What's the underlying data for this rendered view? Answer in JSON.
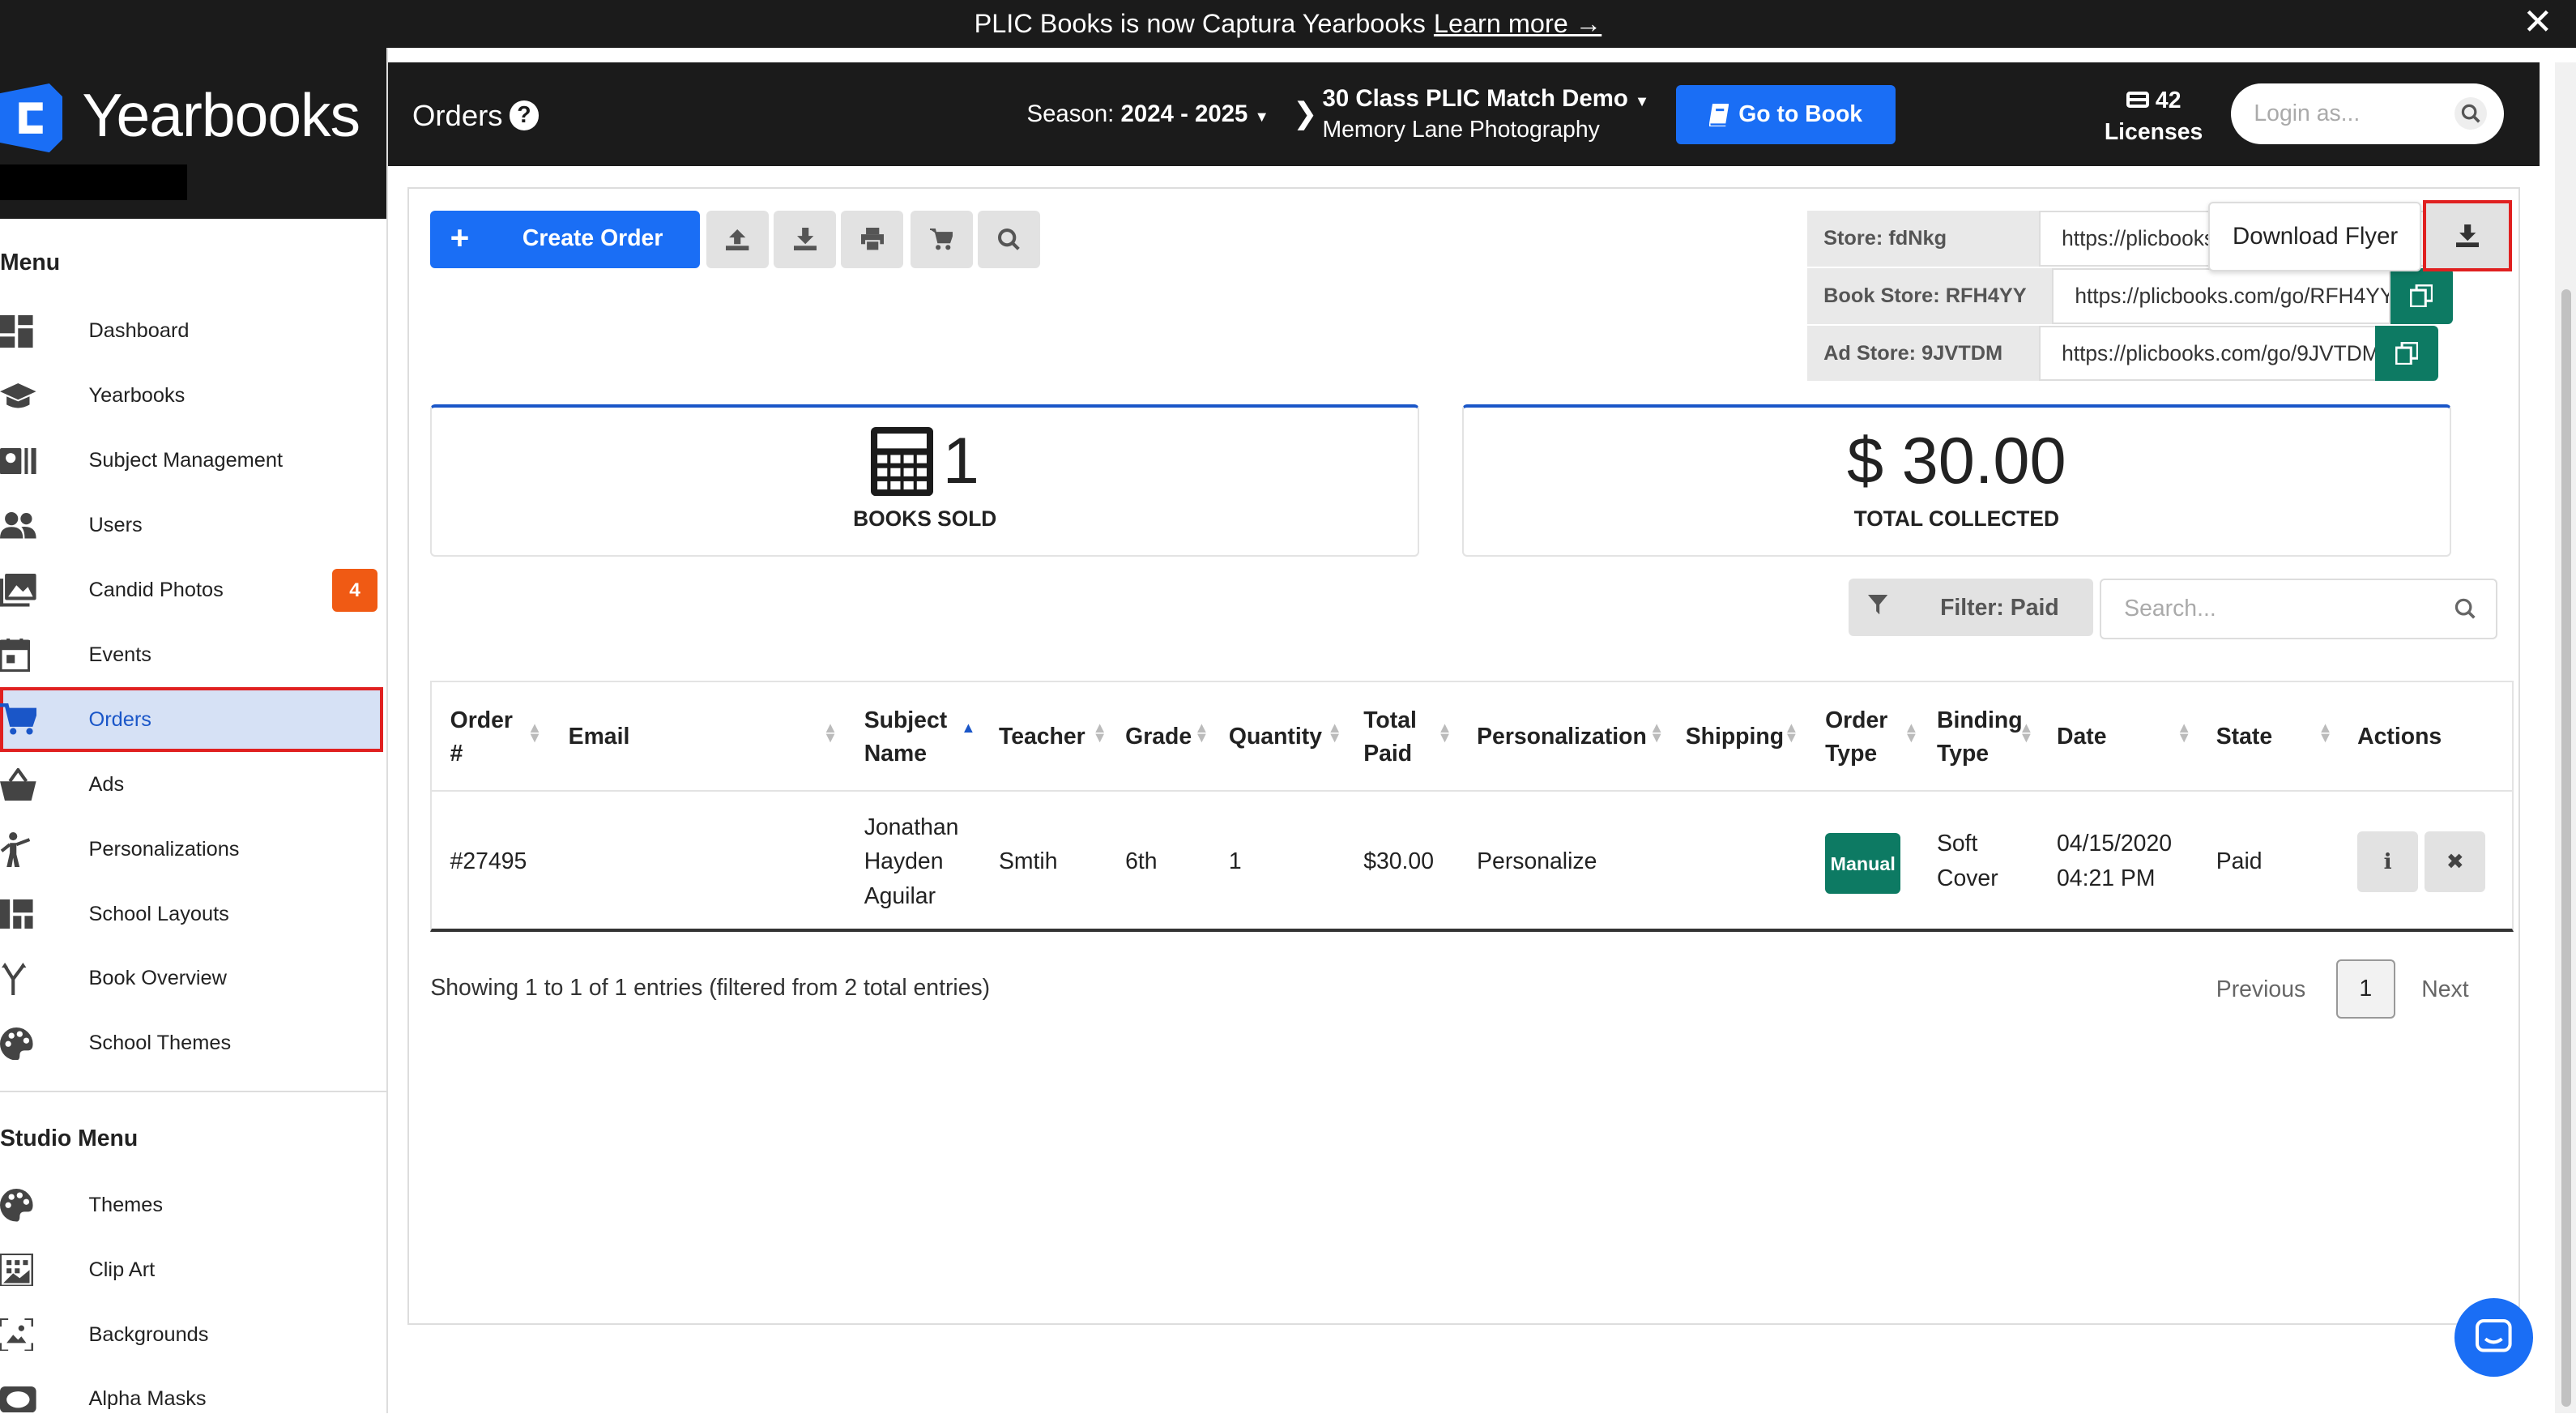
{
  "banner": {
    "text": "PLIC Books is now Captura Yearbooks",
    "link": "Learn more →",
    "close": "✕"
  },
  "brand": {
    "name": "Yearbooks"
  },
  "sidebar": {
    "menu_title": "Menu",
    "items": [
      {
        "label": "Dashboard"
      },
      {
        "label": "Yearbooks"
      },
      {
        "label": "Subject Management"
      },
      {
        "label": "Users"
      },
      {
        "label": "Candid Photos",
        "badge": "4"
      },
      {
        "label": "Events"
      },
      {
        "label": "Orders"
      },
      {
        "label": "Ads"
      },
      {
        "label": "Personalizations"
      },
      {
        "label": "School Layouts"
      },
      {
        "label": "Book Overview"
      },
      {
        "label": "School Themes"
      }
    ],
    "studio_title": "Studio Menu",
    "studio_items": [
      {
        "label": "Themes"
      },
      {
        "label": "Clip Art"
      },
      {
        "label": "Backgrounds"
      },
      {
        "label": "Alpha Masks"
      }
    ]
  },
  "header": {
    "title": "Orders",
    "help": "?",
    "season_label": "Season:",
    "season_value": "2024 - 2025",
    "book_name": "30 Class PLIC Match Demo",
    "book_sub": "Memory Lane Photography",
    "goto_label": "Go to Book",
    "licenses_count": "42",
    "licenses_label": "Licenses",
    "login_placeholder": "Login as..."
  },
  "toolbar": {
    "create_label": "Create Order",
    "create_plus": "+"
  },
  "stores": [
    {
      "label": "Store: fdNkg",
      "url": "https://plicbooks.com/go/fdNkg"
    },
    {
      "label": "Book Store: RFH4YY",
      "url": "https://plicbooks.com/go/RFH4YY"
    },
    {
      "label": "Ad Store: 9JVTDM",
      "url": "https://plicbooks.com/go/9JVTDM"
    }
  ],
  "tooltip": {
    "text": "Download Flyer"
  },
  "stats": {
    "books_sold_value": "1",
    "books_sold_label": "BOOKS SOLD",
    "total_collected_value": "$ 30.00",
    "total_collected_label": "TOTAL COLLECTED"
  },
  "filter": {
    "label": "Filter: Paid",
    "search_placeholder": "Search..."
  },
  "table": {
    "headers": {
      "order": "Order #",
      "email": "Email",
      "subject": "Subject Name",
      "teacher": "Teacher",
      "grade": "Grade",
      "quantity": "Quantity",
      "total": "Total Paid",
      "personalization": "Personalization",
      "shipping": "Shipping",
      "order_type": "Order Type",
      "binding": "Binding Type",
      "date": "Date",
      "state": "State",
      "actions": "Actions"
    },
    "row": {
      "order": "#27495",
      "email": "",
      "subject_1": "Jonathan",
      "subject_2": "Hayden",
      "subject_3": "Aguilar",
      "teacher": "Smtih",
      "grade": "6th",
      "quantity": "1",
      "total": "$30.00",
      "personalization": "Personalize",
      "shipping": "",
      "order_type": "Manual",
      "binding_1": "Soft",
      "binding_2": "Cover",
      "date_1": "04/15/2020",
      "date_2": "04:21 PM",
      "state": "Paid",
      "info": "i",
      "delete": "✖"
    }
  },
  "pagination": {
    "summary": "Showing 1 to 1 of 1 entries (filtered from 2 total entries)",
    "previous": "Previous",
    "page": "1",
    "next": "Next"
  },
  "colors": {
    "primary": "#1a6ef5",
    "dark": "#1b1b1b",
    "teal": "#0d7a63",
    "badge": "#f05a14",
    "highlight": "#e02020"
  }
}
